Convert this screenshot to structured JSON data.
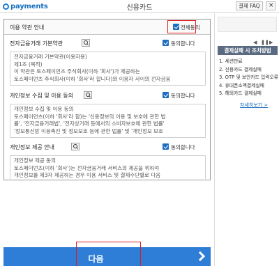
{
  "header": {
    "logo_text": "payments",
    "title": "신용카드",
    "faq_label": "결제 FAQ",
    "close_label": "×"
  },
  "agreement": {
    "title": "이용 약관 안내",
    "all_agree_label": "전체동의",
    "sections": [
      {
        "title": "전자금융거래 기본약관",
        "checkbox_label": "동의합니다",
        "lines": [
          "전자금융거래 기본약관(이용자용)",
          "제1조 (목적)",
          "이 약관은 토스페이먼츠 주식회사(이하 '회사')가 제공하는",
          "토스페이먼츠 주식회사(이하 '회사'라 합니다)와 이용자 사이의 전자금융"
        ]
      },
      {
        "title": "개인정보 수집 및 이용 동의",
        "checkbox_label": "동의합니다",
        "lines": [
          "개인정보 수집 및 이용 동의",
          "토스페이먼츠(이하 '회사'라 함)는 '신용정보의 이용 및 보호에 관한 법",
          "률', '전자금융거래법', '전자상거래 등에서의 소비자보호에 관한 법률'",
          "'정보통신망 이용촉진 및 정보보호 등에 관한 법률' 및 '개인정보 보호"
        ]
      },
      {
        "title": "개인정보 제공 안내",
        "checkbox_label": "동의합니다",
        "lines": [
          "개인정보 제공 동의",
          "토스페이먼츠(이하 '회사')는 전자금융거래 서비스의 제공을 위하여",
          "개인정보를 제3자 제공하는 경우 이용 서비스 및 결제수단별로 다음",
          "과 같습니다."
        ]
      }
    ]
  },
  "next": {
    "label": "다음"
  },
  "side": {
    "ctrl_prev": "◀",
    "ctrl_pause": "❚❚",
    "ctrl_next": "▶",
    "title": "결제실패 시 조치방법",
    "items": [
      "1. 세션만료",
      "2. 신용카드 결제실패",
      "3. OTP 및 보안카드 입력오류",
      "4. 휴대폰소액결제실패",
      "5. 해외카드 결제실패"
    ],
    "more_label": "자세히보기 >"
  },
  "colors": {
    "accent": "#2e7dd6",
    "highlight": "#e01b1b",
    "side_title_bg": "#5a6a80"
  }
}
